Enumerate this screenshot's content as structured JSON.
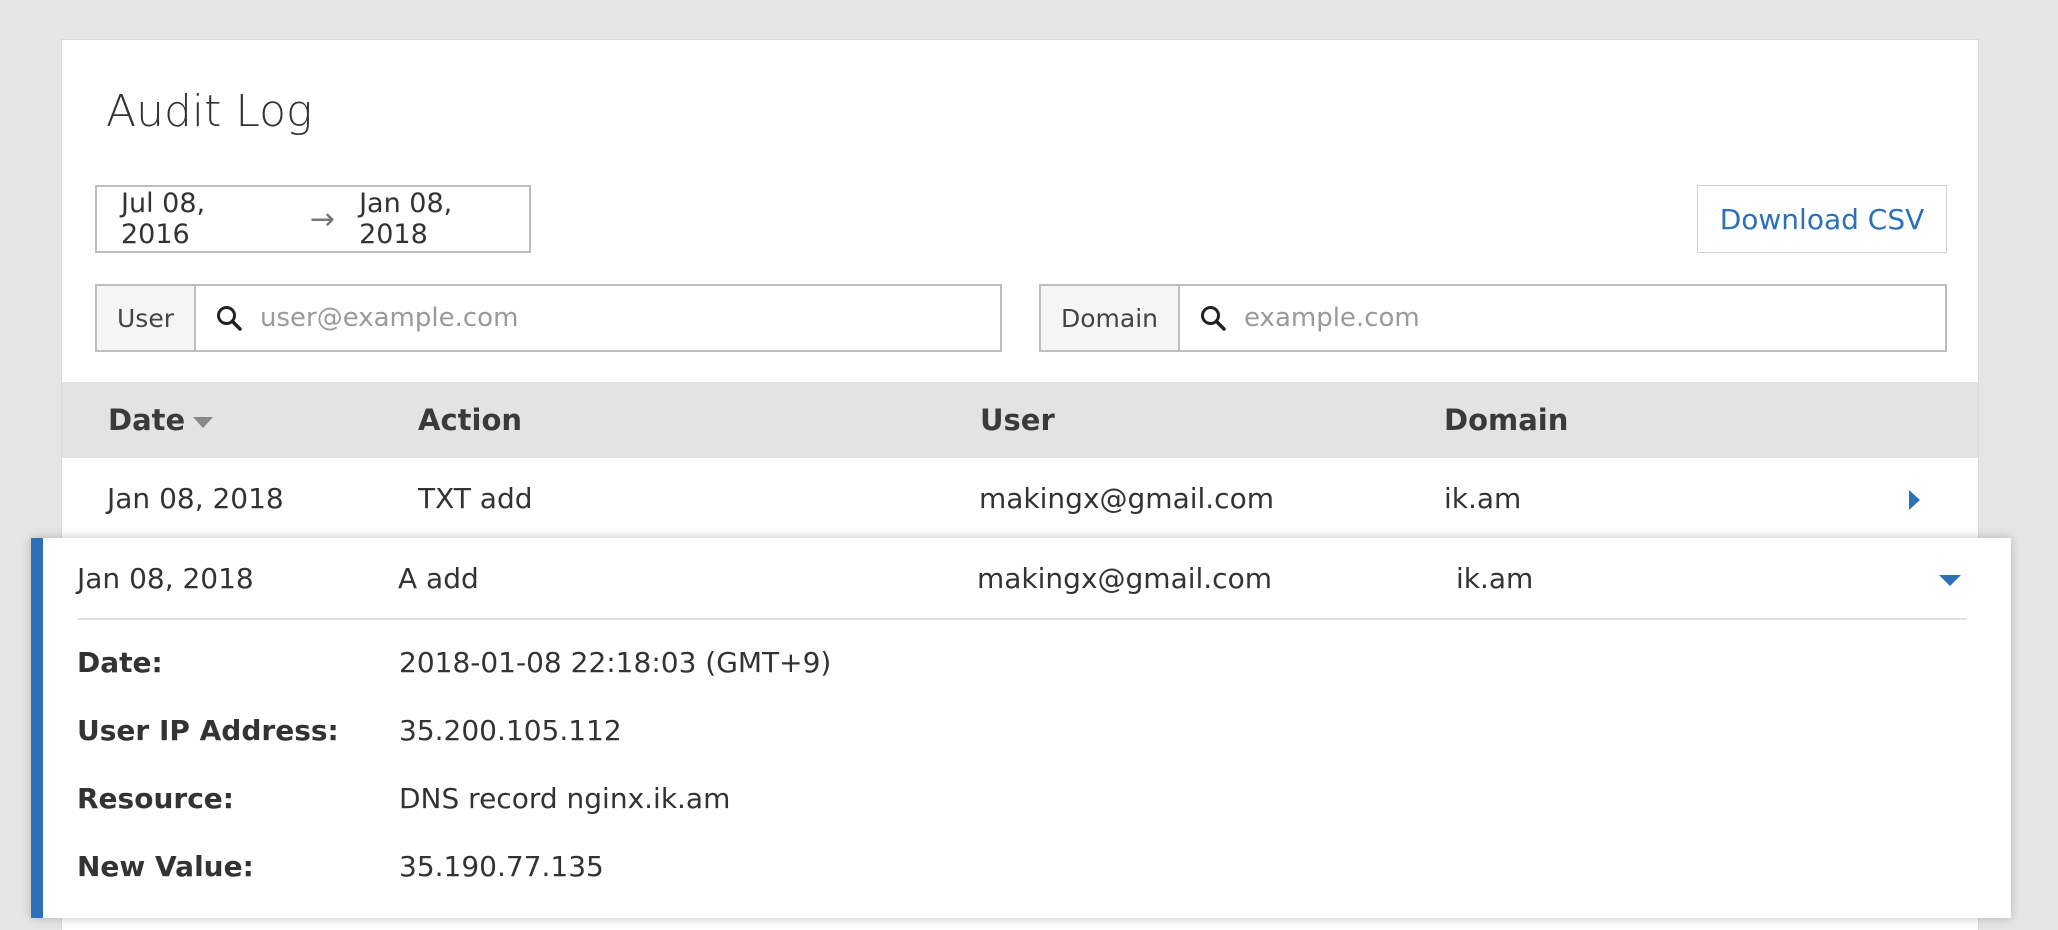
{
  "page": {
    "title": "Audit Log"
  },
  "date_range": {
    "start": "Jul 08, 2016",
    "arrow": "→",
    "end": "Jan 08, 2018"
  },
  "toolbar": {
    "download_label": "Download CSV"
  },
  "filters": {
    "user": {
      "label": "User",
      "placeholder": "user@example.com"
    },
    "domain": {
      "label": "Domain",
      "placeholder": "example.com"
    }
  },
  "table": {
    "columns": [
      "Date",
      "Action",
      "User",
      "Domain"
    ],
    "sort_column": "Date",
    "sort_direction": "descending",
    "rows": [
      {
        "date": "Jan 08, 2018",
        "action": "TXT add",
        "user": "makingx@gmail.com",
        "domain": "ik.am",
        "expanded": false
      },
      {
        "date": "Jan 08, 2018",
        "action": "A add",
        "user": "makingx@gmail.com",
        "domain": "ik.am",
        "expanded": true
      }
    ]
  },
  "expanded_details": [
    {
      "label": "Date:",
      "value": "2018-01-08 22:18:03 (GMT+9)"
    },
    {
      "label": "User IP Address:",
      "value": "35.200.105.112"
    },
    {
      "label": "Resource:",
      "value": "DNS record nginx.ik.am"
    },
    {
      "label": "New Value:",
      "value": "35.190.77.135"
    }
  ],
  "colors": {
    "accent": "#2b70b8",
    "header_bg": "#e3e3e3",
    "page_bg": "#e6e6e6"
  },
  "icons": {
    "search": "search-icon",
    "collapsed": "caret-right-icon",
    "expanded": "caret-down-icon",
    "sort": "sort-desc-icon"
  }
}
